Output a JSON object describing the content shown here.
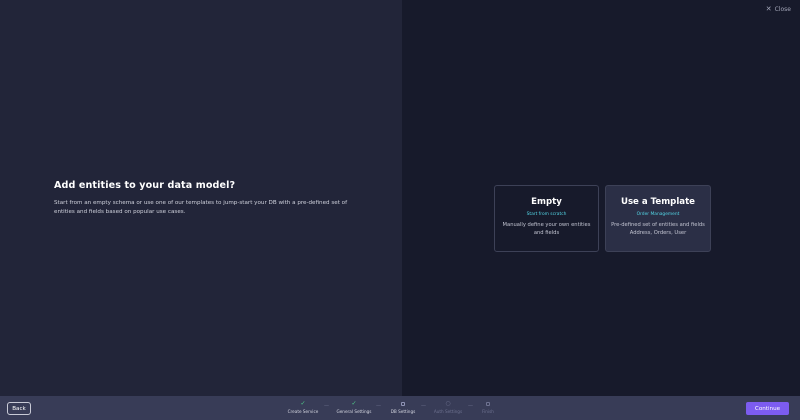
{
  "header": {
    "close_label": "Close",
    "close_icon": "x-icon"
  },
  "main": {
    "heading": "Add entities to your data model?",
    "description": "Start from an empty schema or use one of our templates to jump-start your DB with a pre-defined set of entities and fields based on popular use cases."
  },
  "cards": [
    {
      "title": "Empty",
      "subtitle": "Start from scratch",
      "description": "Manually define your own entities and fields"
    },
    {
      "title": "Use a Template",
      "subtitle": "Order Management",
      "description": "Pre-defined set of entities and fields Address, Orders, User"
    }
  ],
  "footer": {
    "back_label": "Back",
    "continue_label": "Continue",
    "separator": "—",
    "steps": [
      {
        "label": "Create Service",
        "status": "done",
        "icon": "check-icon"
      },
      {
        "label": "General Settings",
        "status": "done",
        "icon": "check-icon"
      },
      {
        "label": "DB Settings",
        "status": "active",
        "icon": "square-icon"
      },
      {
        "label": "Auth Settings",
        "status": "todo",
        "icon": "circle-icon"
      },
      {
        "label": "Finish",
        "status": "todo",
        "icon": "square-icon"
      }
    ]
  },
  "colors": {
    "accent": "#7c5cf0",
    "success": "#4fd18b",
    "highlight": "#53d6e6",
    "left_panel": "#222539",
    "right_panel": "#171a2b",
    "footer": "#383c57"
  }
}
